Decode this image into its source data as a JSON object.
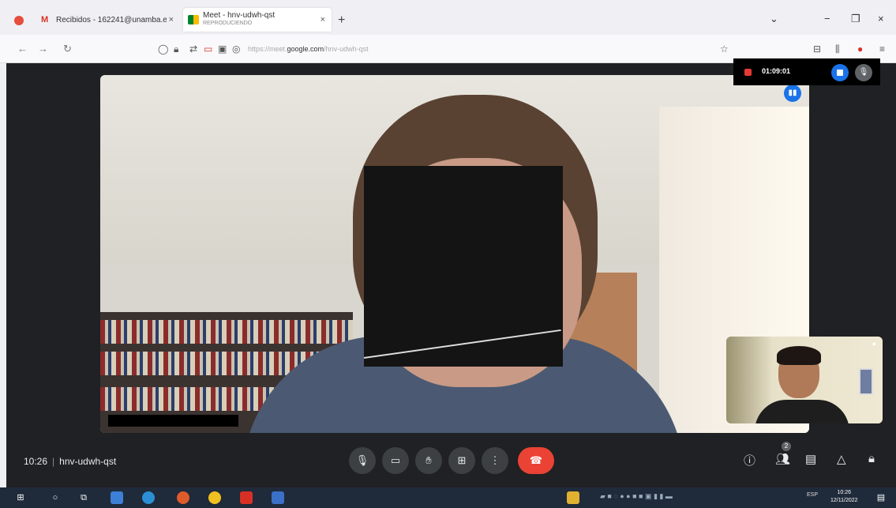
{
  "browser": {
    "tabs": [
      {
        "label": "Recibidos - 162241@unamba.e",
        "close": "×"
      },
      {
        "label": "Meet - hnv-udwh-qst",
        "sublabel": "REPRODUCIENDO",
        "close": "×"
      }
    ],
    "new_tab": "+",
    "window_controls": {
      "menu": "⌄",
      "minimize": "−",
      "restore": "❐",
      "close": "×"
    },
    "url_prefix": "https://meet.",
    "url_domain": "google.com",
    "url_path": "/hnv-udwh-qst"
  },
  "recording": {
    "time": "01:09:01"
  },
  "meeting": {
    "time": "10:26",
    "separator": "|",
    "code": "hnv-udwh-qst",
    "participants_count": "2"
  },
  "taskbar": {
    "time": "10:26",
    "date": "12/11/2022",
    "lang": "ESP"
  },
  "colors": {
    "meet_bg": "#202124",
    "end_call": "#ea4335",
    "accent": "#1a73e8"
  }
}
